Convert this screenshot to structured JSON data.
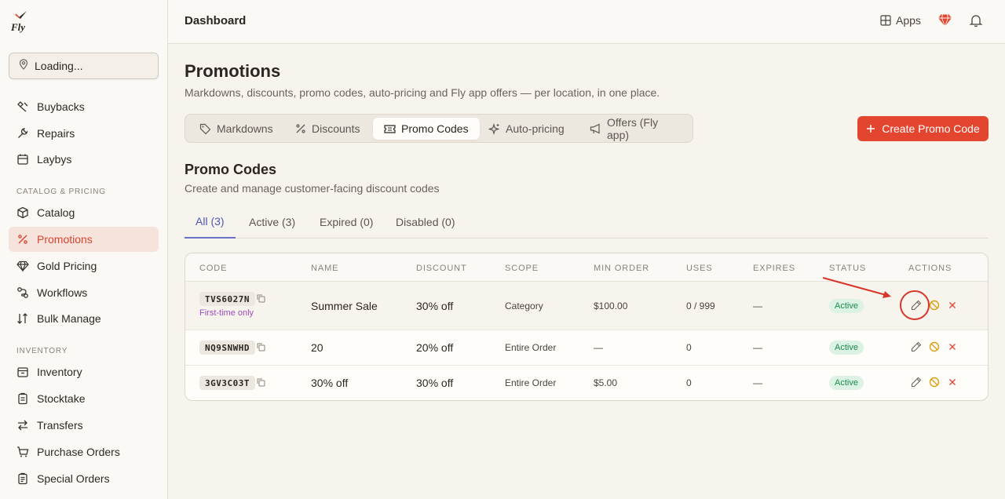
{
  "brand": {
    "logo_text": "Fly",
    "accent": "#e3452f"
  },
  "location": {
    "label": "Loading...",
    "icon": "map-pin-icon"
  },
  "sidebar": {
    "items_top": [
      {
        "label": "Buybacks",
        "icon": "buyback-icon"
      },
      {
        "label": "Repairs",
        "icon": "wrench-icon"
      },
      {
        "label": "Laybys",
        "icon": "calendar-icon"
      }
    ],
    "section_catalog": "CATALOG & PRICING",
    "items_catalog": [
      {
        "label": "Catalog",
        "icon": "box-icon"
      },
      {
        "label": "Promotions",
        "icon": "percent-icon",
        "active": true
      },
      {
        "label": "Gold Pricing",
        "icon": "diamond-icon"
      },
      {
        "label": "Workflows",
        "icon": "workflow-icon"
      },
      {
        "label": "Bulk Manage",
        "icon": "sort-icon"
      }
    ],
    "section_inventory": "INVENTORY",
    "items_inventory": [
      {
        "label": "Inventory",
        "icon": "inventory-icon"
      },
      {
        "label": "Stocktake",
        "icon": "clipboard-icon"
      },
      {
        "label": "Transfers",
        "icon": "transfer-icon"
      },
      {
        "label": "Purchase Orders",
        "icon": "cart-icon"
      },
      {
        "label": "Special Orders",
        "icon": "clipboard-list-icon"
      }
    ]
  },
  "header": {
    "title": "Dashboard",
    "apps_label": "Apps"
  },
  "page": {
    "title": "Promotions",
    "subtitle": "Markdowns, discounts, promo codes, auto-pricing and Fly app offers — per location, in one place.",
    "tabs": [
      {
        "label": "Markdowns",
        "icon": "tag-icon"
      },
      {
        "label": "Discounts",
        "icon": "percent-icon"
      },
      {
        "label": "Promo Codes",
        "icon": "ticket-icon",
        "active": true
      },
      {
        "label": "Auto-pricing",
        "icon": "sparkle-icon"
      },
      {
        "label": "Offers (Fly app)",
        "icon": "megaphone-icon"
      }
    ],
    "create_button": "Create Promo Code"
  },
  "promo": {
    "title": "Promo Codes",
    "subtitle": "Create and manage customer-facing discount codes",
    "filters": [
      {
        "label": "All (3)",
        "active": true
      },
      {
        "label": "Active (3)"
      },
      {
        "label": "Expired (0)"
      },
      {
        "label": "Disabled (0)"
      }
    ],
    "columns": [
      "CODE",
      "NAME",
      "DISCOUNT",
      "SCOPE",
      "MIN ORDER",
      "USES",
      "EXPIRES",
      "STATUS",
      "ACTIONS"
    ],
    "rows": [
      {
        "code": "TVS6027N",
        "note": "First-time only",
        "name": "Summer Sale",
        "discount": "30% off",
        "scope": "Category",
        "min_order": "$100.00",
        "uses": "0 / 999",
        "expires": "—",
        "status": "Active"
      },
      {
        "code": "NQ9SNWHD",
        "note": "",
        "name": "20",
        "discount": "20% off",
        "scope": "Entire Order",
        "min_order": "—",
        "uses": "0",
        "expires": "—",
        "status": "Active"
      },
      {
        "code": "3GV3C03T",
        "note": "",
        "name": "30% off",
        "discount": "30% off",
        "scope": "Entire Order",
        "min_order": "$5.00",
        "uses": "0",
        "expires": "—",
        "status": "Active"
      }
    ]
  },
  "colors": {
    "active_nav_bg": "#f6e3dc",
    "active_badge_bg": "#dcf2e4",
    "active_badge_text": "#1e8a4c",
    "annotation": "#d8352a"
  }
}
